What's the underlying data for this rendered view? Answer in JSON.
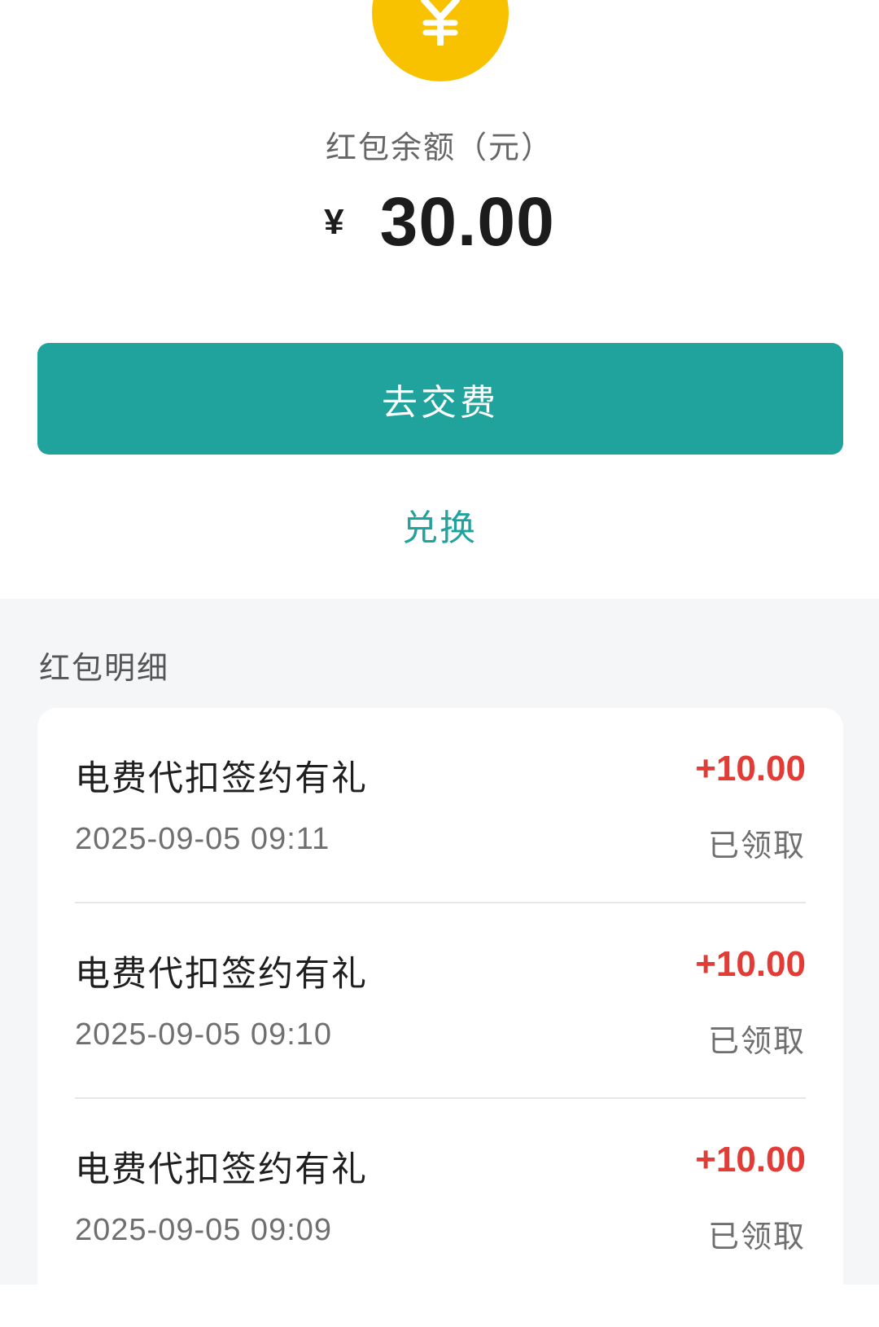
{
  "header": {
    "coin_icon": "yuan-coin-icon",
    "balance_label": "红包余额（元）",
    "currency_symbol": "¥",
    "balance_value": "30.00"
  },
  "actions": {
    "pay_label": "去交费",
    "exchange_label": "兑换"
  },
  "details": {
    "title": "红包明细",
    "records": [
      {
        "title": "电费代扣签约有礼",
        "amount": "+10.00",
        "time": "2025-09-05 09:11",
        "status": "已领取"
      },
      {
        "title": "电费代扣签约有礼",
        "amount": "+10.00",
        "time": "2025-09-05 09:10",
        "status": "已领取"
      },
      {
        "title": "电费代扣签约有礼",
        "amount": "+10.00",
        "time": "2025-09-05 09:09",
        "status": "已领取"
      }
    ]
  },
  "colors": {
    "accent": "#20a29d",
    "coin": "#f8c200",
    "amount_red": "#e23c36",
    "section_bg": "#f5f6f8"
  }
}
